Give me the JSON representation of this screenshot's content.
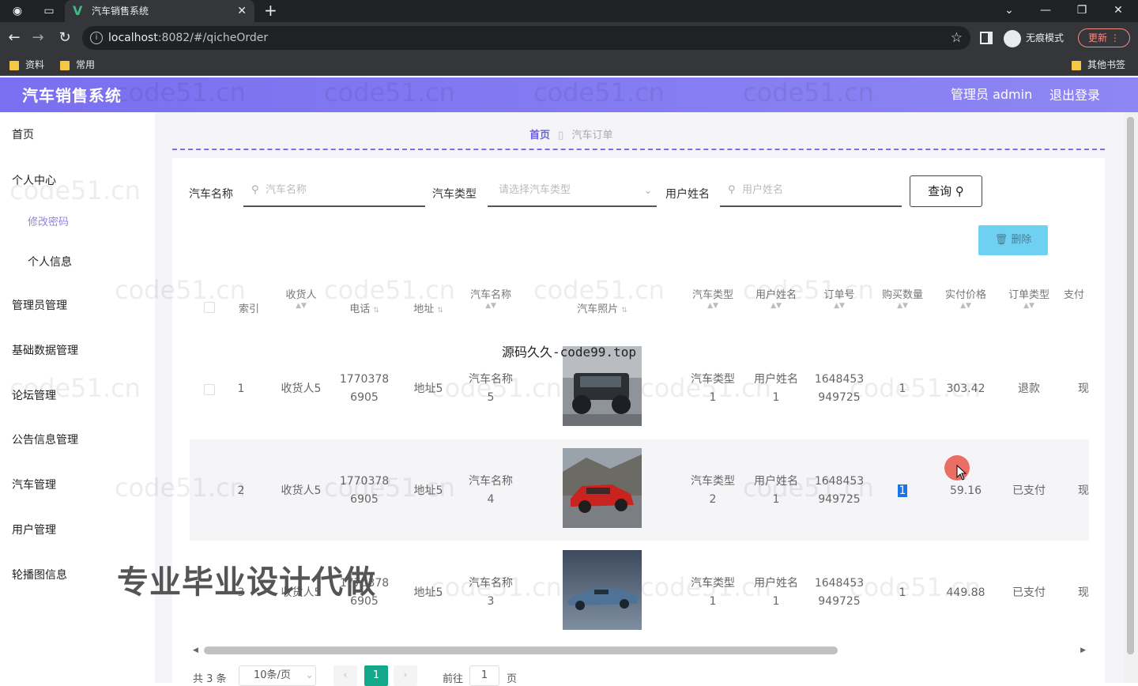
{
  "browser": {
    "tab_title": "汽车销售系统",
    "url_host": "localhost",
    "url_rest": ":8082/#/qicheOrder",
    "incognito_label": "无痕模式",
    "update_label": "更新",
    "bookmarks": [
      "资料",
      "常用"
    ],
    "other_bookmarks": "其他书签"
  },
  "header": {
    "app_title": "汽车销售系统",
    "admin_label": "管理员 admin",
    "logout_label": "退出登录"
  },
  "sidebar": {
    "home": "首页",
    "personal_center": "个人中心",
    "change_password": "修改密码",
    "personal_info": "个人信息",
    "admin_mgmt": "管理员管理",
    "base_data_mgmt": "基础数据管理",
    "forum_mgmt": "论坛管理",
    "notice_mgmt": "公告信息管理",
    "car_mgmt": "汽车管理",
    "user_mgmt": "用户管理",
    "carousel_mgmt": "轮播图信息"
  },
  "breadcrumb": {
    "home": "首页",
    "current": "汽车订单"
  },
  "filters": {
    "car_name_label": "汽车名称",
    "car_name_placeholder": "汽车名称",
    "car_type_label": "汽车类型",
    "car_type_placeholder": "请选择汽车类型",
    "user_name_label": "用户姓名",
    "user_name_placeholder": "用户姓名",
    "query_button": "查询",
    "delete_button": "删除"
  },
  "table": {
    "headers": {
      "index": "索引",
      "receiver": "收货人",
      "phone": "电话",
      "address": "地址",
      "car_name": "汽车名称",
      "car_photo": "汽车照片",
      "car_type": "汽车类型",
      "user_name": "用户姓名",
      "order_no": "订单号",
      "quantity": "购买数量",
      "paid_price": "实付价格",
      "order_type": "订单类型",
      "pay_status": "支付"
    },
    "rows": [
      {
        "index": "1",
        "receiver": "收货人5",
        "phone_a": "1770378",
        "phone_b": "6905",
        "address": "地址5",
        "car_name_a": "汽车名称",
        "car_name_b": "5",
        "car_type_a": "汽车类型",
        "car_type_b": "1",
        "user_a": "用户姓名",
        "user_b": "1",
        "order_a": "1648453",
        "order_b": "949725",
        "quantity": "1",
        "price": "303.42",
        "order_type": "退款",
        "pay": "现"
      },
      {
        "index": "2",
        "receiver": "收货人5",
        "phone_a": "1770378",
        "phone_b": "6905",
        "address": "地址5",
        "car_name_a": "汽车名称",
        "car_name_b": "4",
        "car_type_a": "汽车类型",
        "car_type_b": "2",
        "user_a": "用户姓名",
        "user_b": "1",
        "order_a": "1648453",
        "order_b": "949725",
        "quantity": "1",
        "price": "59.16",
        "order_type": "已支付",
        "pay": "现"
      },
      {
        "index": "3",
        "receiver": "收货人5",
        "phone_a": "1770378",
        "phone_b": "6905",
        "address": "地址5",
        "car_name_a": "汽车名称",
        "car_name_b": "3",
        "car_type_a": "汽车类型",
        "car_type_b": "1",
        "user_a": "用户姓名",
        "user_b": "1",
        "order_a": "1648453",
        "order_b": "949725",
        "quantity": "1",
        "price": "449.88",
        "order_type": "已支付",
        "pay": "现"
      }
    ]
  },
  "pagination": {
    "total": "共 3 条",
    "page_size": "10条/页",
    "current_page": "1",
    "goto_label": "前往",
    "goto_value": "1",
    "page_label": "页"
  },
  "overlays": {
    "code99": "源码久久-code99.top",
    "promo": "专业毕业设计代做",
    "watermark": "code51.cn"
  },
  "colors": {
    "header_accent": "#7a6ff0",
    "active_page": "#13a889",
    "delete_button": "#6ed1f2"
  }
}
